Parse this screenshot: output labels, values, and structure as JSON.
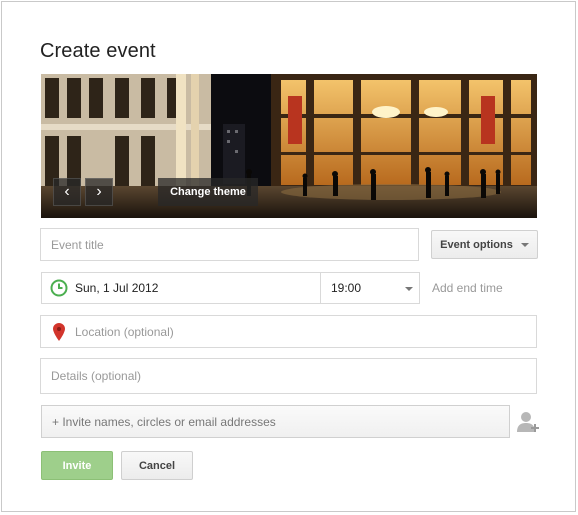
{
  "dialog": {
    "title": "Create event"
  },
  "banner": {
    "prev_icon": "chevron-left-icon",
    "next_icon": "chevron-right-icon",
    "change_theme_label": "Change theme"
  },
  "form": {
    "event_title_placeholder": "Event title",
    "event_options_label": "Event options",
    "date_value": "Sun, 1 Jul 2012",
    "time_value": "19:00",
    "add_end_time_label": "Add end time",
    "location_placeholder": "Location (optional)",
    "details_placeholder": "Details (optional)",
    "invite_placeholder": "+ Invite names, circles or email addresses"
  },
  "actions": {
    "invite_label": "Invite",
    "cancel_label": "Cancel"
  },
  "colors": {
    "invite_green": "#9ecf8b",
    "clock_green": "#4caf50",
    "pin_red": "#d2352c"
  }
}
